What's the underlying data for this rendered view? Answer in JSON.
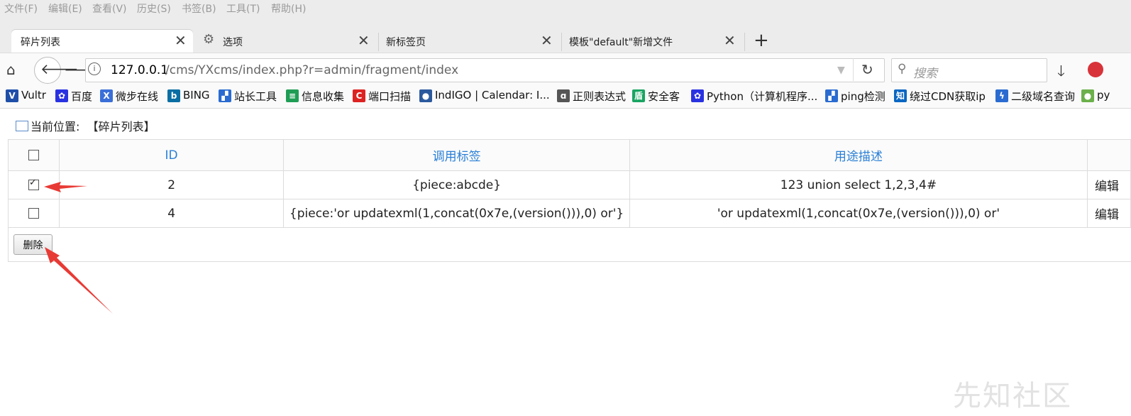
{
  "menubar": [
    "文件(F)",
    "编辑(E)",
    "查看(V)",
    "历史(S)",
    "书签(B)",
    "工具(T)",
    "帮助(H)"
  ],
  "tabs": [
    {
      "label": "碎片列表",
      "close": "✕"
    },
    {
      "label": "选项",
      "close": "✕"
    },
    {
      "label": "新标签页",
      "close": "✕"
    },
    {
      "label": "模板\"default\"新增文件",
      "close": "✕"
    }
  ],
  "new_tab": "+",
  "nav": {
    "url_host": "127.0.0.1",
    "url_path": "/cms/YXcms/index.php?r=admin/fragment/index",
    "search_placeholder": "搜索"
  },
  "bookmarks": [
    {
      "label": "Vultr",
      "icon": "vultr-icon",
      "color": "#1e4ea8"
    },
    {
      "label": "百度",
      "icon": "baidu-paw-icon",
      "color": "#2932e1"
    },
    {
      "label": "微步在线",
      "icon": "threatbook-icon",
      "color": "#3b6fd8"
    },
    {
      "label": "BING",
      "icon": "bing-icon",
      "color": "#0a6ea3"
    },
    {
      "label": "站长工具",
      "icon": "chinaz-icon",
      "color": "#2a6bd1"
    },
    {
      "label": "信息收集",
      "icon": "sheet-icon",
      "color": "#1f9d55"
    },
    {
      "label": "端口扫描",
      "icon": "c-icon",
      "color": "#d22"
    },
    {
      "label": "IndIGO | Calendar: I...",
      "icon": "indigo-icon",
      "color": "#2b5a9e"
    },
    {
      "label": "正则表达式",
      "icon": "regex-icon",
      "color": "#555"
    },
    {
      "label": "安全客",
      "icon": "anquanke-icon",
      "color": "#19a463"
    },
    {
      "label": "Python（计算机程序...",
      "icon": "baidu-paw-icon",
      "color": "#2932e1"
    },
    {
      "label": "ping检测",
      "icon": "chinaz-icon",
      "color": "#2a6bd1"
    },
    {
      "label": "绕过CDN获取ip",
      "icon": "zhihu-icon",
      "color": "#0a66c2"
    },
    {
      "label": "二级域名查询",
      "icon": "lightning-icon",
      "color": "#2a6bd1"
    },
    {
      "label": "py",
      "icon": "green-circle-icon",
      "color": "#6bb04a"
    }
  ],
  "page": {
    "breadcrumb_label": "当前位置:",
    "breadcrumb_value": "【碎片列表】",
    "columns": [
      "ID",
      "调用标签",
      "用途描述",
      ""
    ],
    "rows": [
      {
        "checked": true,
        "id": "2",
        "tag": "{piece:abcde}",
        "desc": "123 union select 1,2,3,4#",
        "action": "编辑"
      },
      {
        "checked": false,
        "id": "4",
        "tag": "{piece:'or updatexml(1,concat(0x7e,(version())),0) or'}",
        "desc": "'or updatexml(1,concat(0x7e,(version())),0) or'",
        "action": "编辑"
      }
    ],
    "delete_button": "删除"
  },
  "watermark": "先知社区",
  "colors": {
    "accent": "#2a7fd6",
    "arrow": "#e83a35"
  }
}
